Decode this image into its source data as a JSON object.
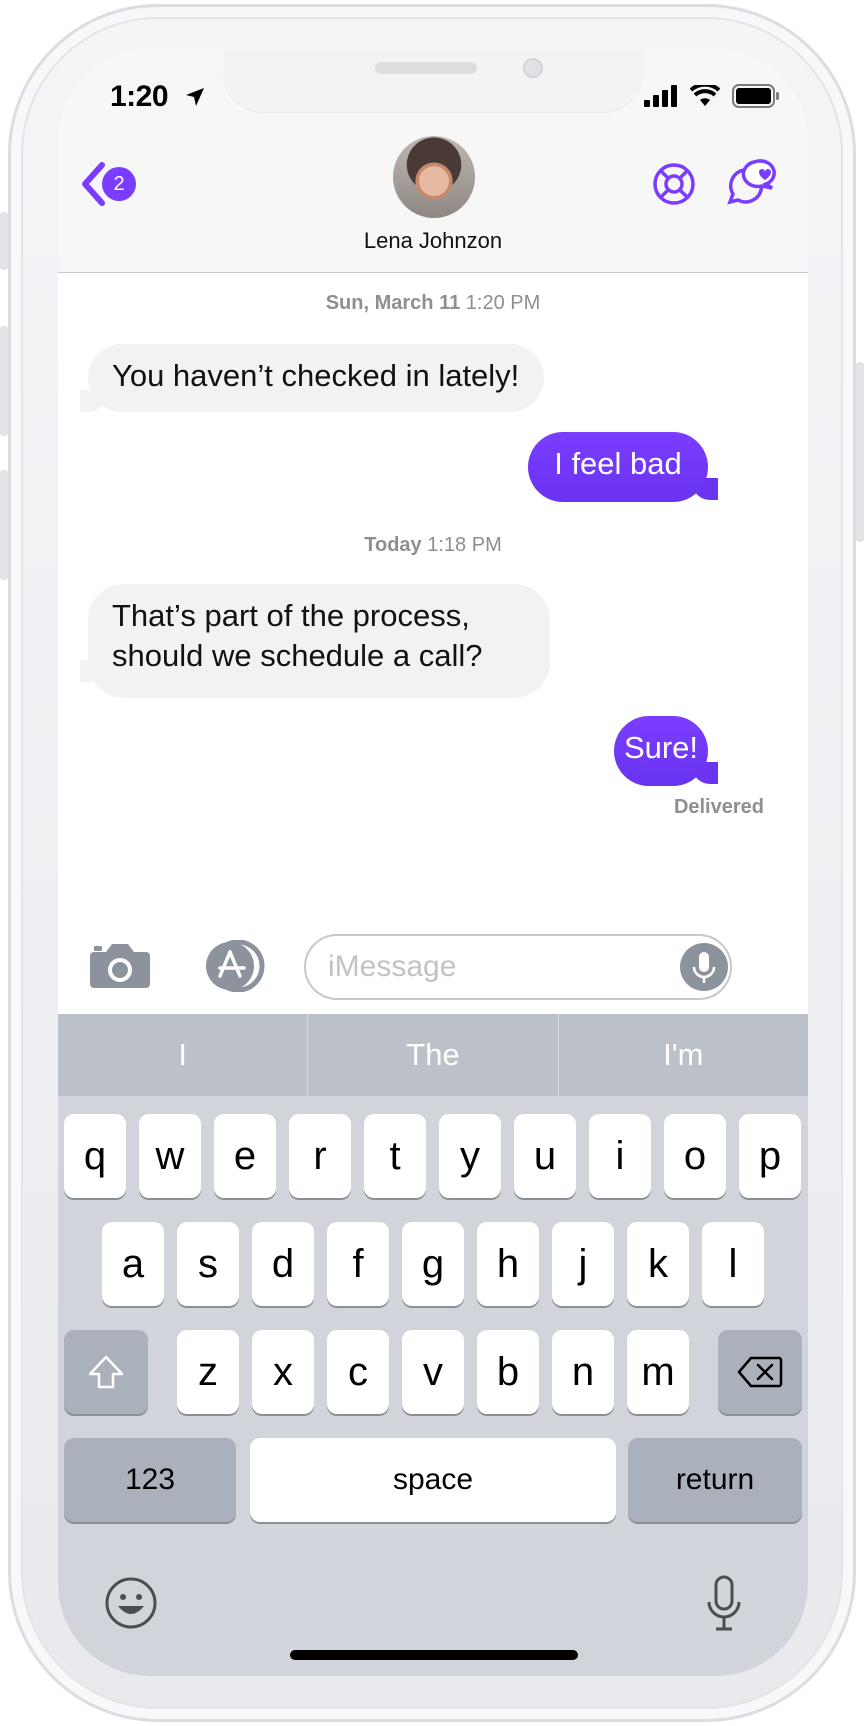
{
  "status": {
    "time": "1:20",
    "location_icon": "location-arrow-icon",
    "icons": [
      "signal-icon",
      "wifi-icon",
      "battery-icon"
    ]
  },
  "header": {
    "back_badge": "2",
    "contact_name": "Lena Johnzon",
    "accent": "#7a3dff",
    "icons": [
      "lifebuoy-icon",
      "chat-heart-icon"
    ]
  },
  "conversation": {
    "stamp1_day": "Sun, March 11",
    "stamp1_time": "1:20 PM",
    "msg1": "You haven’t checked in lately!",
    "msg2": "I feel bad",
    "stamp2_day": "Today",
    "stamp2_time": "1:18 PM",
    "msg3_line1": "That’s part of the process,",
    "msg3_line2": "should we schedule a call?",
    "msg4": "Sure!",
    "delivered": "Delivered"
  },
  "composer": {
    "placeholder": "iMessage"
  },
  "keyboard": {
    "suggestions": [
      "I",
      "The",
      "I'm"
    ],
    "row1": [
      "q",
      "w",
      "e",
      "r",
      "t",
      "y",
      "u",
      "i",
      "o",
      "p"
    ],
    "row2": [
      "a",
      "s",
      "d",
      "f",
      "g",
      "h",
      "j",
      "k",
      "l"
    ],
    "row3": [
      "z",
      "x",
      "c",
      "v",
      "b",
      "n",
      "m"
    ],
    "numbers": "123",
    "space": "space",
    "return": "return"
  }
}
